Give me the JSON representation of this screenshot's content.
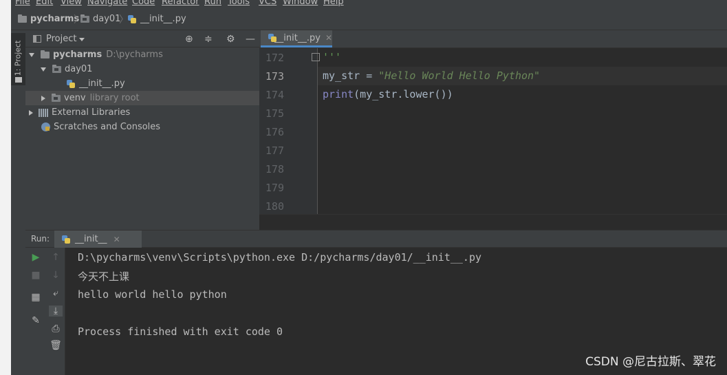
{
  "menu": [
    "File",
    "Edit",
    "View",
    "Navigate",
    "Code",
    "Refactor",
    "Run",
    "Tools",
    "VCS",
    "Window",
    "Help"
  ],
  "breadcrumb": {
    "project": "pycharms",
    "folder": "day01",
    "file": "__init__.py"
  },
  "side_tab": "1: Project",
  "project_panel": {
    "title": "Project",
    "tree": [
      {
        "label": "pycharms",
        "hint": "D:\\pycharms"
      },
      {
        "label": "day01"
      },
      {
        "label": "__init__.py"
      },
      {
        "label": "venv",
        "hint": "library root"
      },
      {
        "label": "External Libraries"
      },
      {
        "label": "Scratches and Consoles"
      }
    ]
  },
  "editor": {
    "tab": "__init__.py",
    "line_numbers": [
      "172",
      "173",
      "174",
      "175",
      "176",
      "177",
      "178",
      "179",
      "180"
    ],
    "code": {
      "l172": "'''",
      "l173_var": "my_str = ",
      "l173_str": "\"Hello World Hello Python\"",
      "l174_fn": "print",
      "l174_rest": "(my_str.lower())"
    }
  },
  "run": {
    "label": "Run:",
    "tab": "__init__",
    "output": [
      "D:\\pycharms\\venv\\Scripts\\python.exe D:/pycharms/day01/__init__.py",
      "今天不上课",
      "hello world hello python",
      "",
      "Process finished with exit code 0"
    ]
  },
  "watermark": "CSDN @尼古拉斯、翠花",
  "colors": {
    "background": "#2b2b2b",
    "panel": "#3c3f41",
    "accent": "#4a88c7",
    "run_green": "#499c54",
    "string": "#6a8759"
  }
}
